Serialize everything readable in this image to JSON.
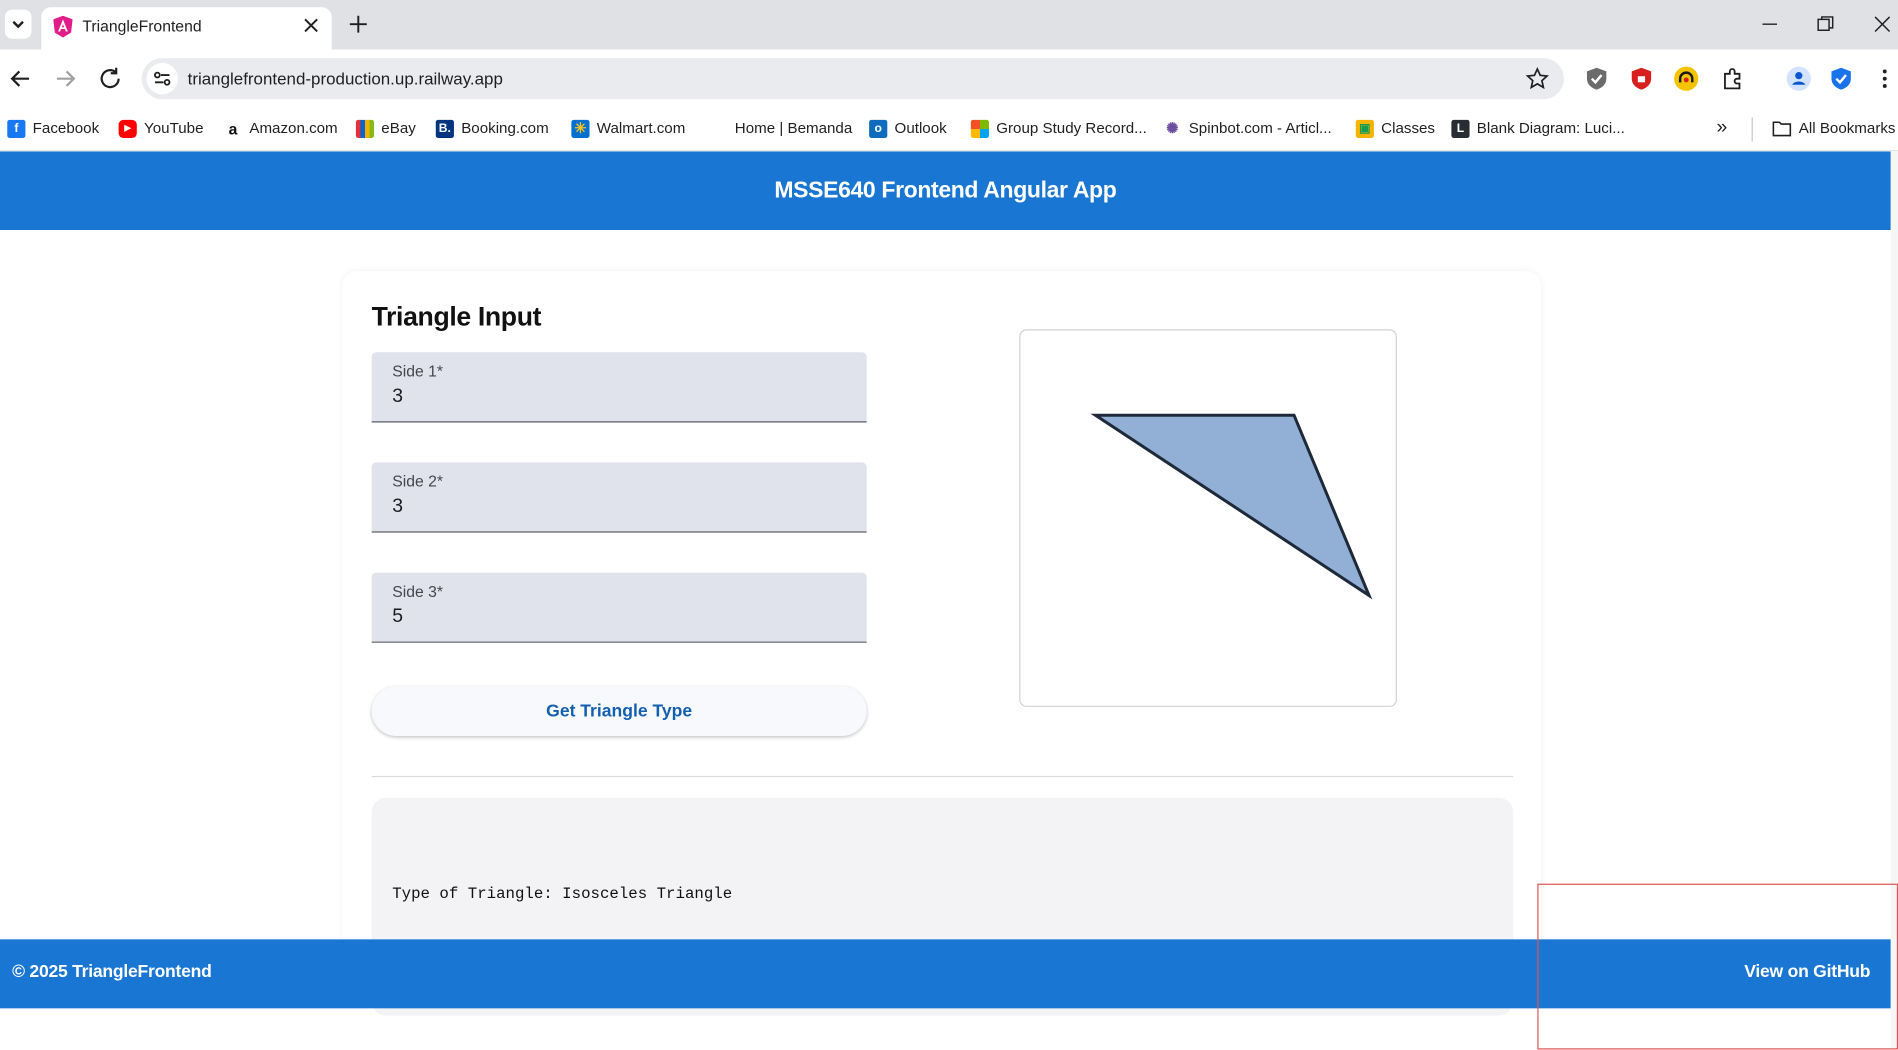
{
  "browser": {
    "tab_title": "TriangleFrontend",
    "url": "trianglefrontend-production.up.railway.app",
    "bookmarks": [
      {
        "label": "Facebook",
        "icon": "facebook-icon",
        "color": "#1877f2"
      },
      {
        "label": "YouTube",
        "icon": "youtube-icon",
        "color": "#ff0000"
      },
      {
        "label": "Amazon.com",
        "icon": "amazon-icon",
        "color": "#111111"
      },
      {
        "label": "eBay",
        "icon": "ebay-icon",
        "color": "#e53238"
      },
      {
        "label": "Booking.com",
        "icon": "booking-icon",
        "color": "#003580"
      },
      {
        "label": "Walmart.com",
        "icon": "walmart-icon",
        "color": "#0071ce"
      },
      {
        "label": "Home | Bemanda",
        "icon": "bemanda-icon",
        "color": "#ffffff"
      },
      {
        "label": "Outlook",
        "icon": "outlook-icon",
        "color": "#0f6cbd"
      },
      {
        "label": "Group Study Record...",
        "icon": "microsoft-icon",
        "color": "#f25022"
      },
      {
        "label": "Spinbot.com - Articl...",
        "icon": "spinbot-icon",
        "color": "#6b4ea0"
      },
      {
        "label": "Classes",
        "icon": "classroom-icon",
        "color": "#f4b400"
      },
      {
        "label": "Blank Diagram: Luci...",
        "icon": "lucidchart-icon",
        "color": "#282c33"
      }
    ],
    "all_bookmarks_label": "All Bookmarks"
  },
  "app": {
    "header_title": "MSSE640 Frontend Angular App",
    "card_title": "Triangle Input",
    "fields": [
      {
        "label": "Side 1*",
        "value": "3"
      },
      {
        "label": "Side 2*",
        "value": "3"
      },
      {
        "label": "Side 3*",
        "value": "5"
      }
    ],
    "button_label": "Get Triangle Type",
    "result_text": "Type of Triangle: Isosceles Triangle",
    "footer_copyright": "© 2025 TriangleFrontend",
    "footer_link": "View on GitHub"
  },
  "colors": {
    "primary": "#1976d2",
    "triangle_fill": "#92b0d6",
    "triangle_stroke": "#1e2a3a"
  }
}
